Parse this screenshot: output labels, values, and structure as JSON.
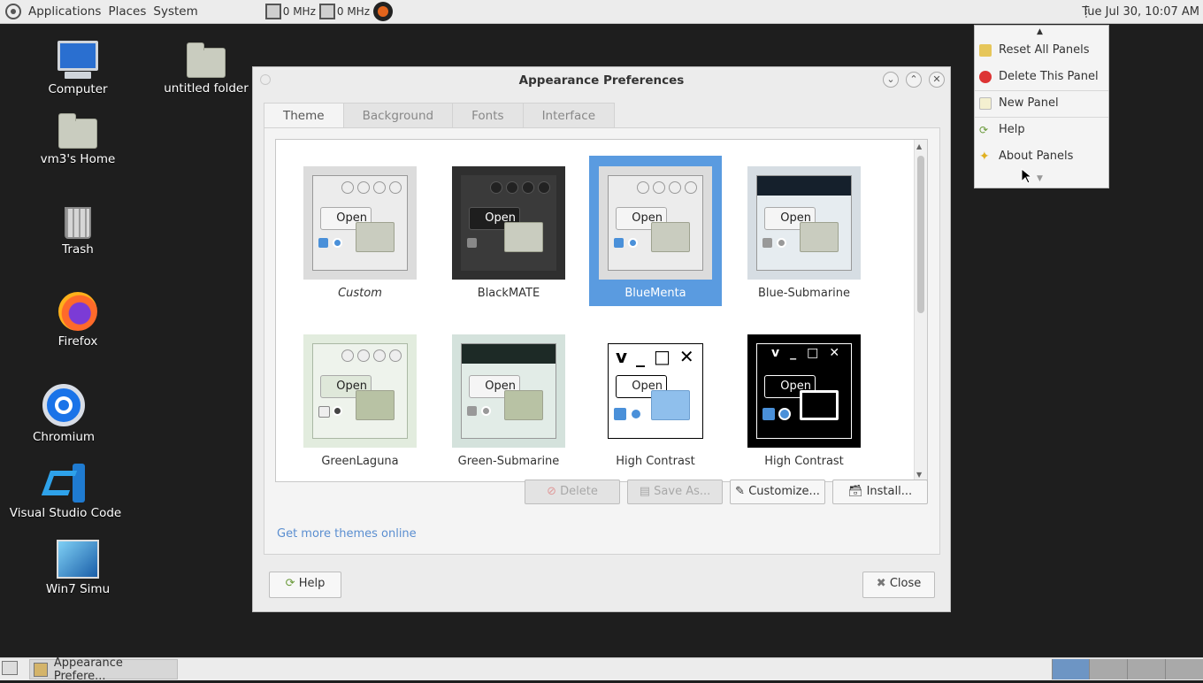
{
  "top_panel": {
    "menus": [
      "Applications",
      "Places",
      "System"
    ],
    "cpu1": "0 MHz",
    "cpu2": "0 MHz",
    "clock": "Tue Jul 30, 10:07 AM"
  },
  "desktop": {
    "icons": [
      {
        "label": "Computer"
      },
      {
        "label": "untitled folder"
      },
      {
        "label": "vm3's Home"
      },
      {
        "label": "Trash"
      },
      {
        "label": "Firefox"
      },
      {
        "label": "Chromium"
      },
      {
        "label": "Visual Studio Code"
      },
      {
        "label": "Win7 Simu"
      }
    ]
  },
  "dialog": {
    "title": "Appearance Preferences",
    "tabs": [
      "Theme",
      "Background",
      "Fonts",
      "Interface"
    ],
    "active_tab": "Theme",
    "themes": [
      {
        "name": "Custom",
        "style": "light"
      },
      {
        "name": "BlackMATE",
        "style": "dark"
      },
      {
        "name": "BlueMenta",
        "style": "light",
        "selected": true
      },
      {
        "name": "Blue-Submarine",
        "style": "submarine"
      },
      {
        "name": "GreenLaguna",
        "style": "green"
      },
      {
        "name": "Green-Submarine",
        "style": "submarine-green"
      },
      {
        "name": "High Contrast",
        "style": "hc"
      },
      {
        "name": "High Contrast",
        "style": "hc-inverse"
      }
    ],
    "preview_open": "Open",
    "buttons": {
      "delete": "Delete",
      "save_as": "Save As...",
      "customize": "Customize...",
      "install": "Install..."
    },
    "link": "Get more themes online",
    "help": "Help",
    "close": "Close"
  },
  "context_menu": {
    "items": [
      "Reset All Panels",
      "Delete This Panel",
      "New Panel",
      "Help",
      "About Panels"
    ]
  },
  "taskbar": {
    "task_label": "Appearance Prefere..."
  }
}
